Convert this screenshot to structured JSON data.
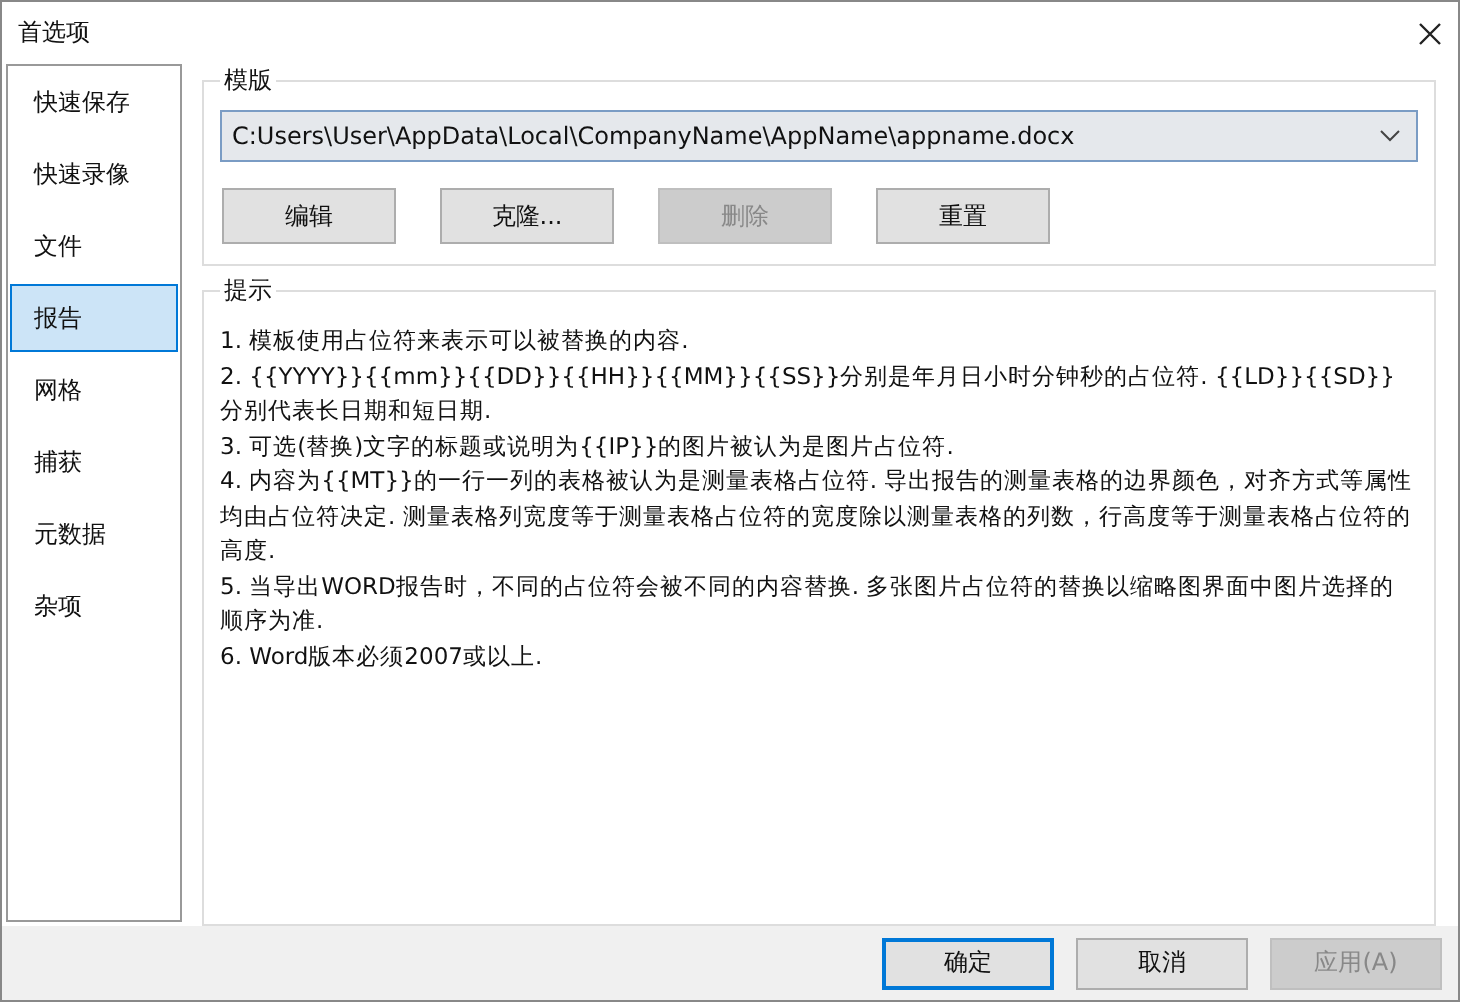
{
  "window": {
    "title": "首选项"
  },
  "sidebar": {
    "items": [
      {
        "label": "快速保存",
        "selected": false
      },
      {
        "label": "快速录像",
        "selected": false
      },
      {
        "label": "文件",
        "selected": false
      },
      {
        "label": "报告",
        "selected": true
      },
      {
        "label": "网格",
        "selected": false
      },
      {
        "label": "捕获",
        "selected": false
      },
      {
        "label": "元数据",
        "selected": false
      },
      {
        "label": "杂项",
        "selected": false
      }
    ]
  },
  "template": {
    "title": "模版",
    "path": "C:Users\\User\\AppData\\Local\\CompanyName\\AppName\\appname.docx",
    "buttons": [
      {
        "label": "编辑",
        "disabled": false
      },
      {
        "label": "克隆...",
        "disabled": false
      },
      {
        "label": "删除",
        "disabled": true
      },
      {
        "label": "重置",
        "disabled": false
      }
    ]
  },
  "hints": {
    "title": "提示",
    "lines": [
      "1. 模板使用占位符来表示可以被替换的内容.",
      "2. {{YYYY}}{{mm}}{{DD}}{{HH}}{{MM}}{{SS}}分别是年月日小时分钟秒的占位符. {{LD}}{{SD}}分别代表长日期和短日期.",
      "3. 可选(替换)文字的标题或说明为{{IP}}的图片被认为是图片占位符.",
      "4. 内容为{{MT}}的一行一列的表格被认为是测量表格占位符. 导出报告的测量表格的边界颜色，对齐方式等属性均由占位符决定. 测量表格列宽度等于测量表格占位符的宽度除以测量表格的列数，行高度等于测量表格占位符的高度.",
      "5. 当导出WORD报告时，不同的占位符会被不同的内容替换. 多张图片占位符的替换以缩略图界面中图片选择的顺序为准.",
      "6. Word版本必须2007或以上."
    ]
  },
  "footer_buttons": [
    {
      "label": "确定",
      "disabled": false,
      "default": true
    },
    {
      "label": "取消",
      "disabled": false,
      "default": false
    },
    {
      "label": "应用(A)",
      "disabled": true,
      "default": false
    }
  ]
}
